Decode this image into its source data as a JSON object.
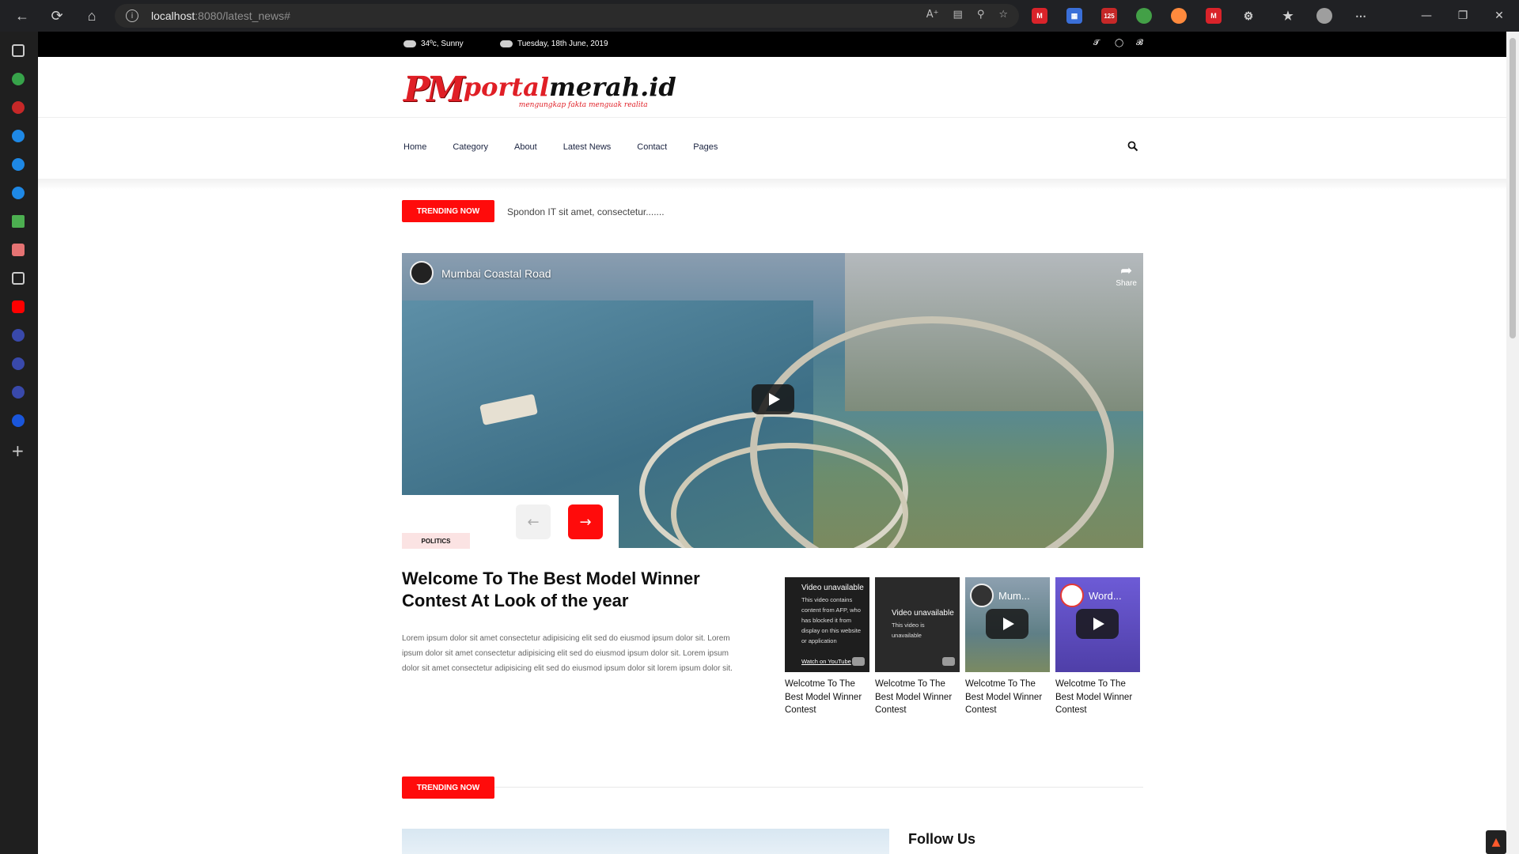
{
  "browser": {
    "url_host": "localhost",
    "url_path": ":8080/latest_news#",
    "badge_count": "125"
  },
  "topbar": {
    "weather": "34ºc, Sunny",
    "date": "Tuesday, 18th June, 2019"
  },
  "logo": {
    "mark": "PM",
    "word_red": "portal",
    "word_black": "merah.id",
    "tagline": "mengungkap fakta menguak realita"
  },
  "menu": {
    "items": [
      "Home",
      "Category",
      "About",
      "Latest News",
      "Contact",
      "Pages"
    ]
  },
  "trending": {
    "label": "TRENDING NOW",
    "text": "Spondon IT sit amet, consectetur.......",
    "label_2": "TRENDING NOW"
  },
  "video": {
    "title": "Mumbai Coastal Road",
    "share": "Share"
  },
  "article": {
    "category": "POLITICS",
    "headline": "Welcome To The Best Model Winner Contest At Look of the year",
    "excerpt": "Lorem ipsum dolor sit amet consectetur adipisicing elit sed do eiusmod ipsum dolor sit. Lorem ipsum dolor sit amet consectetur adipisicing elit sed do eiusmod ipsum dolor sit. Lorem ipsum dolor sit amet consectetur adipisicing elit sed do eiusmod ipsum dolor sit lorem ipsum dolor sit."
  },
  "thumbnails": [
    {
      "type": "unavailable",
      "title": "Video unavailable",
      "body": "This video contains content from AFP, who has blocked it from display on this website or application",
      "link": "Watch on YouTube",
      "caption": "Welcotme To The Best Model Winner Contest"
    },
    {
      "type": "unavailable",
      "title": "Video unavailable",
      "body": "This video is unavailable",
      "link": "",
      "caption": "Welcotme To The Best Model Winner Contest"
    },
    {
      "type": "video",
      "title": "Mum...",
      "caption": "Welcotme To The Best Model Winner Contest"
    },
    {
      "type": "video",
      "title": "Word...",
      "caption": "Welcotme To The Best Model Winner Contest"
    }
  ],
  "sidebar_section": {
    "follow_title": "Follow Us"
  },
  "colors": {
    "accent": "#ff0b0b",
    "badge_bg": "#fbe3e3",
    "topbar": "#000000"
  }
}
